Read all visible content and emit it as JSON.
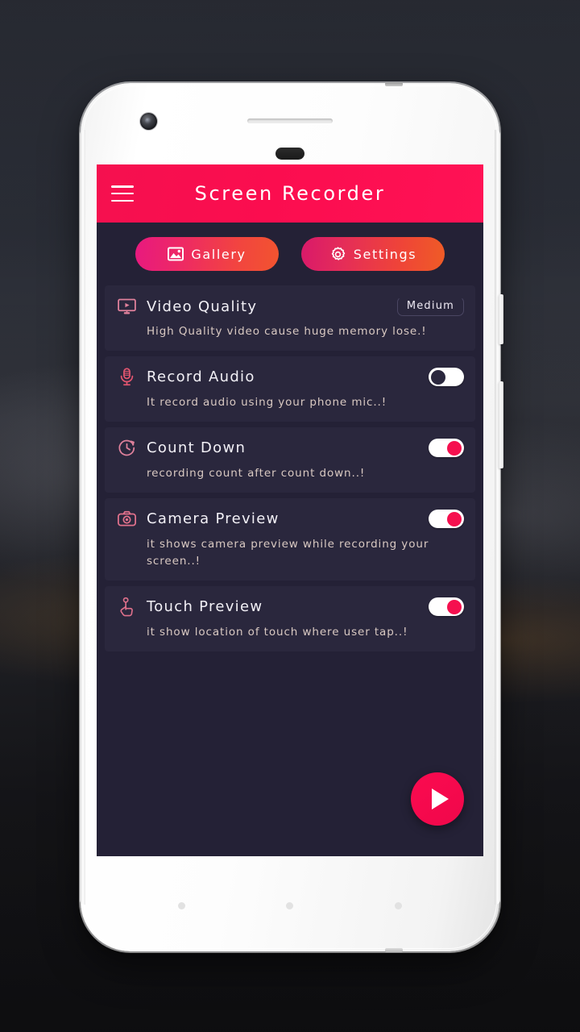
{
  "app": {
    "title": "Screen Recorder",
    "accent_color": "#f5104f",
    "screen_bg_color": "#242136",
    "card_bg_color": "#2a273d"
  },
  "appbar": {
    "menu_icon": "hamburger-menu-icon",
    "title": "Screen Recorder"
  },
  "quick_actions": [
    {
      "label": "Gallery",
      "icon": "image-icon"
    },
    {
      "label": "Settings",
      "icon": "gear-icon"
    }
  ],
  "settings": [
    {
      "key": "video_quality",
      "icon": "monitor-play-icon",
      "title": "Video Quality",
      "description": "High Quality video cause huge memory lose.!",
      "control": "chip",
      "value": "Medium"
    },
    {
      "key": "record_audio",
      "icon": "microphone-icon",
      "title": "Record Audio",
      "description": "It record audio using your phone mic..!",
      "control": "toggle",
      "value": "off"
    },
    {
      "key": "count_down",
      "icon": "clock-timer-icon",
      "title": "Count Down",
      "description": "recording count after count down..!",
      "control": "toggle",
      "value": "on"
    },
    {
      "key": "camera_preview",
      "icon": "camera-icon",
      "title": "Camera Preview",
      "description": "it shows camera preview while recording your screen..!",
      "control": "toggle",
      "value": "on"
    },
    {
      "key": "touch_preview",
      "icon": "hand-tap-icon",
      "title": "Touch Preview",
      "description": "it show location of touch where user tap..!",
      "control": "toggle",
      "value": "on"
    }
  ],
  "fab": {
    "icon": "play-icon",
    "label": "Start recording"
  },
  "device": {
    "front_camera": "front-camera-lens",
    "earpiece": "earpiece-speaker",
    "sensor": "proximity-sensor",
    "nav_dots": 3
  }
}
